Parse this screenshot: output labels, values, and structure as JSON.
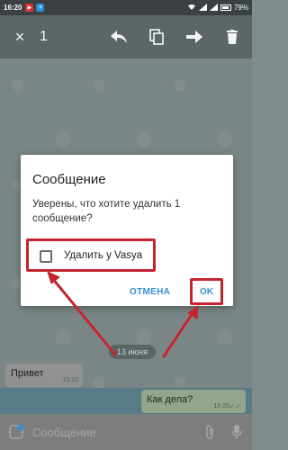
{
  "status_bar": {
    "time": "16:20",
    "battery": "79%"
  },
  "action_bar": {
    "close_icon": "×",
    "selected_count": "1"
  },
  "chat": {
    "date_chip": "13 июня",
    "incoming": {
      "text": "Привет",
      "time": "15:20"
    },
    "outgoing": {
      "text": "Как дела?",
      "time": "15:20"
    }
  },
  "input": {
    "placeholder": "Сообщение"
  },
  "dialog": {
    "title": "Сообщение",
    "body": "Уверены, что хотите удалить 1 сообщение?",
    "checkbox_label": "Удалить у Vasya",
    "cancel_label": "ОТМЕНА",
    "ok_label": "OK"
  },
  "colors": {
    "accent": "#3a8fcf",
    "annotation": "#c5252d"
  }
}
